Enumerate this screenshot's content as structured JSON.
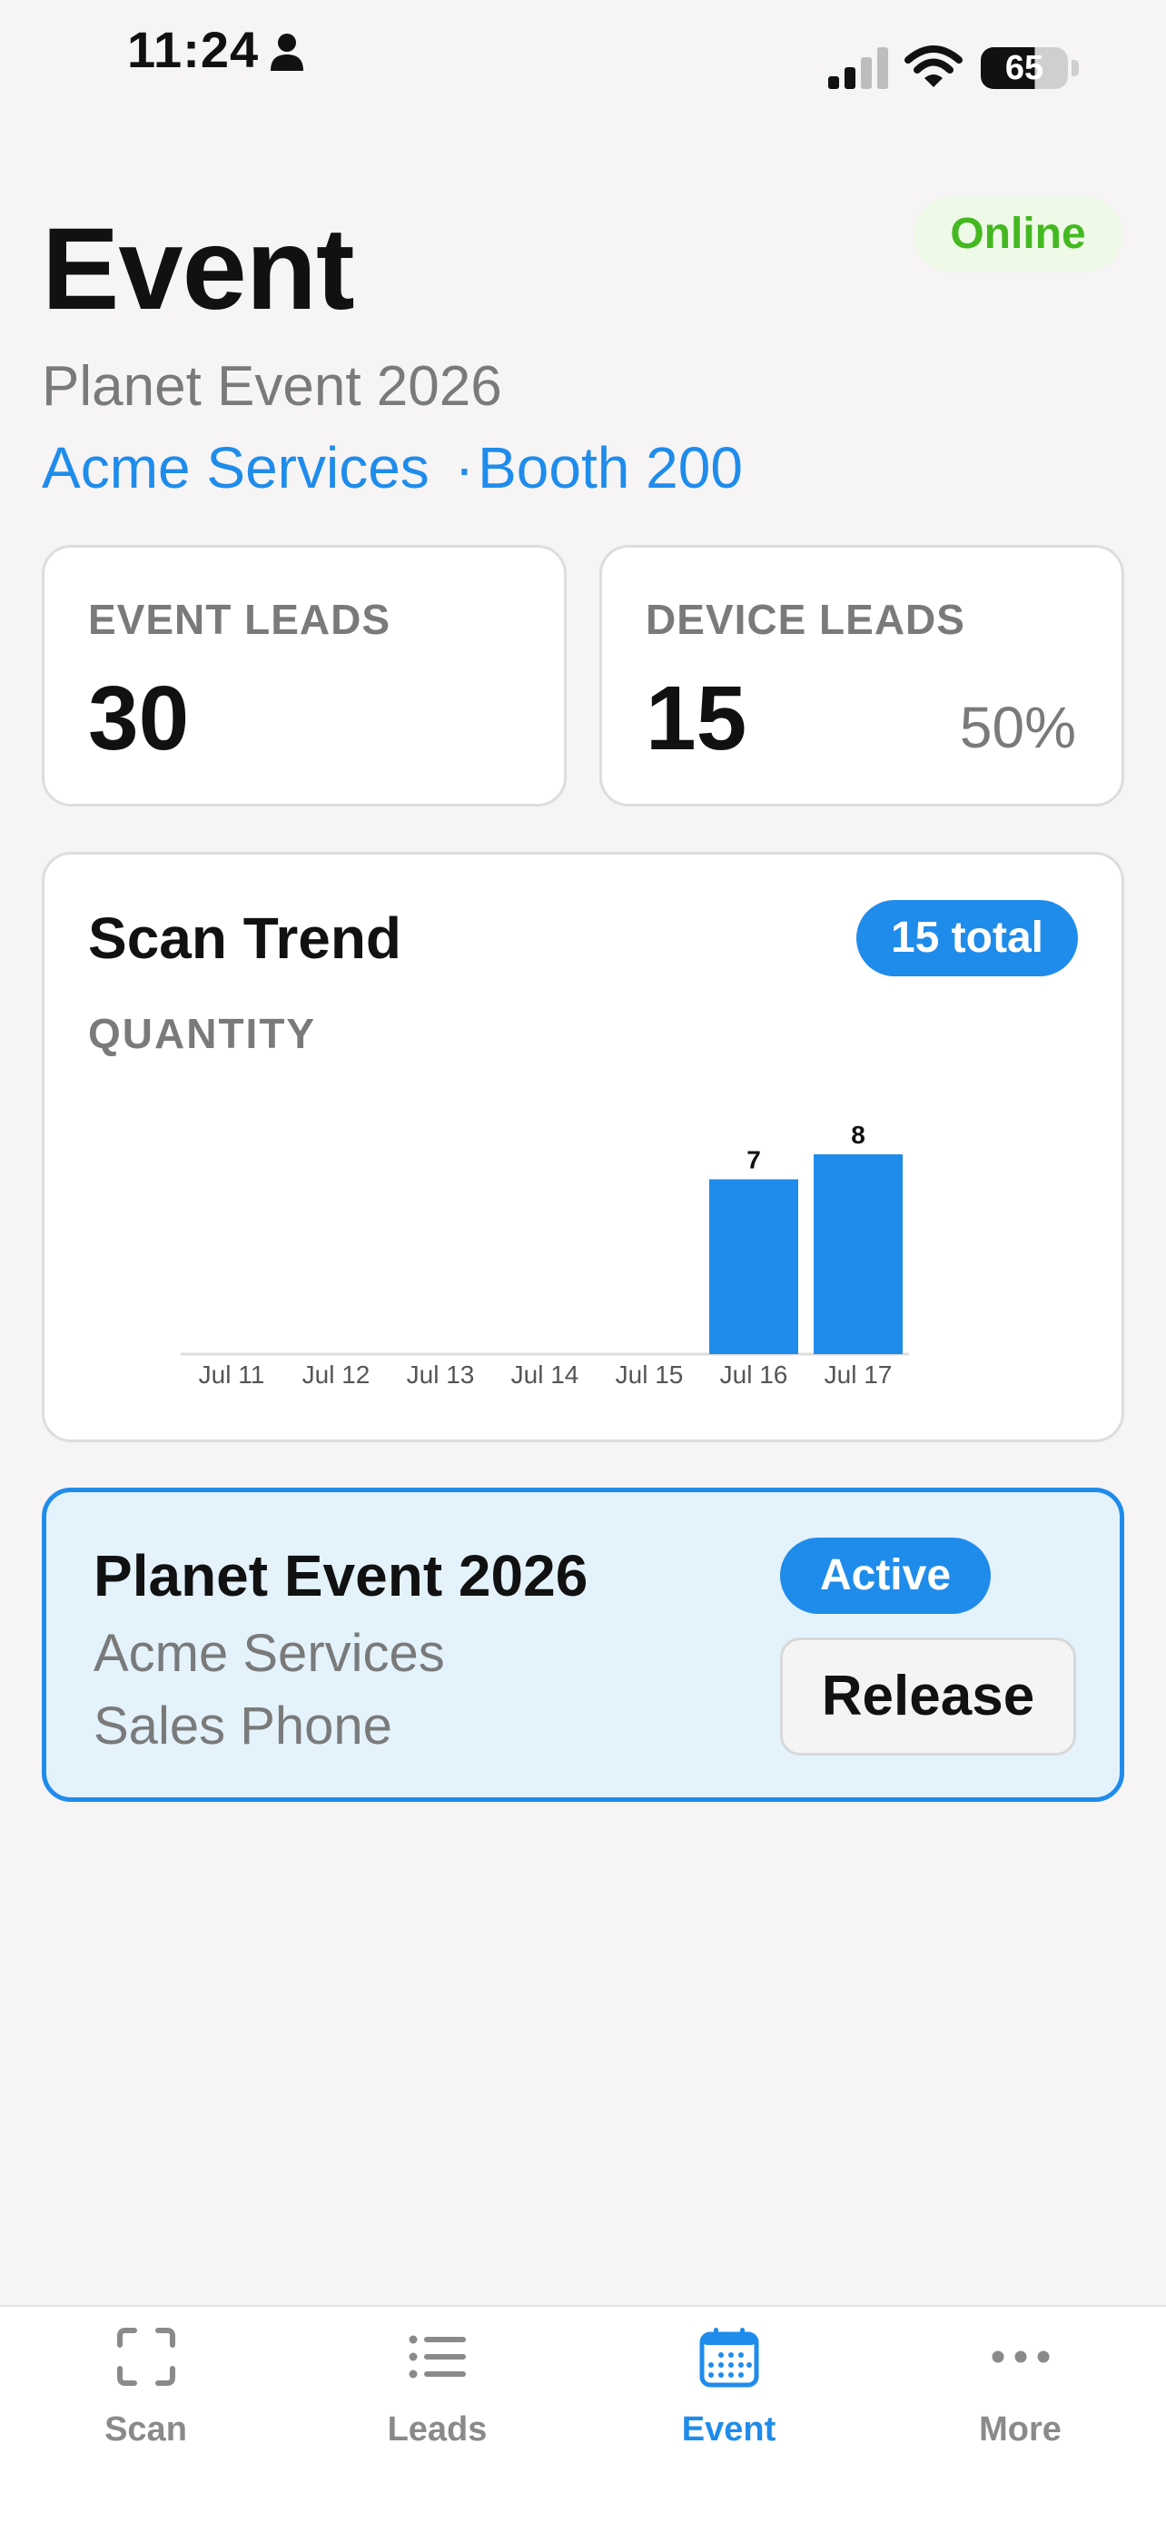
{
  "status_bar": {
    "time": "11:24",
    "battery": "65"
  },
  "header": {
    "title": "Event",
    "connection_status": "Online",
    "event_name": "Planet Event 2026",
    "company": "Acme Services",
    "separator": "·",
    "booth": "Booth 200"
  },
  "stats": {
    "event_leads": {
      "label": "EVENT LEADS",
      "value": "30"
    },
    "device_leads": {
      "label": "DEVICE LEADS",
      "value": "15",
      "percent": "50%"
    }
  },
  "scan_trend": {
    "title": "Scan Trend",
    "total_badge": "15 total"
  },
  "chart_data": {
    "type": "bar",
    "title": "Scan Trend",
    "ylabel": "QUANTITY",
    "xlabel": "",
    "categories": [
      "Jul 11",
      "Jul 12",
      "Jul 13",
      "Jul 14",
      "Jul 15",
      "Jul 16",
      "Jul 17"
    ],
    "values": [
      0,
      0,
      0,
      0,
      0,
      7,
      8
    ],
    "ylim": [
      0,
      8
    ],
    "grid": false,
    "color": "#1f8ceb"
  },
  "active_event": {
    "name": "Planet Event 2026",
    "company": "Acme Services",
    "device": "Sales Phone",
    "status_badge": "Active",
    "release_label": "Release"
  },
  "tabs": [
    {
      "label": "Scan",
      "icon": "scan-frame-icon",
      "active": false
    },
    {
      "label": "Leads",
      "icon": "list-icon",
      "active": false
    },
    {
      "label": "Event",
      "icon": "calendar-icon",
      "active": true
    },
    {
      "label": "More",
      "icon": "more-dots-icon",
      "active": false
    }
  ],
  "colors": {
    "accent": "#1f8ceb",
    "online": "#43b820",
    "online_bg": "#eef9e8",
    "active_card_bg": "#e4f2fc",
    "muted_text": "#7a7a7a",
    "background": "#f6f4f5"
  }
}
